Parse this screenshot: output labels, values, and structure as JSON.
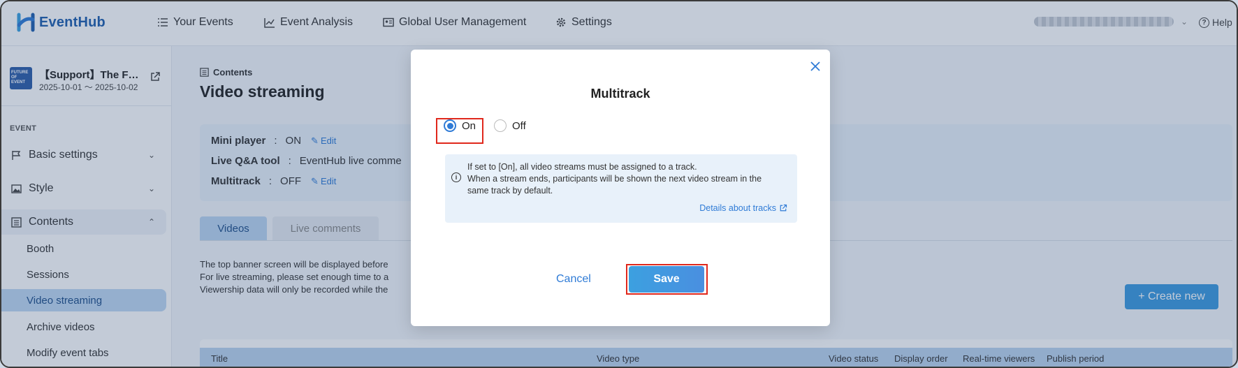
{
  "app": {
    "name": "EventHub"
  },
  "topnav": {
    "items": [
      {
        "label": "Your Events",
        "icon": "list-icon"
      },
      {
        "label": "Event Analysis",
        "icon": "chart-icon"
      },
      {
        "label": "Global User Management",
        "icon": "id-card-icon"
      },
      {
        "label": "Settings",
        "icon": "gear-icon"
      }
    ],
    "help_label": "Help"
  },
  "sidebar": {
    "event_title": "【Support】The F…",
    "event_dates": "2025-10-01 ～ 2025-10-02",
    "thumb_text": "FUTURE OF EVENT",
    "section_label": "EVENT",
    "items": [
      {
        "label": "Basic settings",
        "icon": "flag-icon"
      },
      {
        "label": "Style",
        "icon": "image-icon"
      },
      {
        "label": "Contents",
        "icon": "list-icon"
      }
    ],
    "subitems": [
      "Booth",
      "Sessions",
      "Video streaming",
      "Archive videos",
      "Modify event tabs"
    ]
  },
  "main": {
    "breadcrumb": "Contents",
    "title": "Video streaming",
    "settings": [
      {
        "label": "Mini player",
        "value": "ON",
        "edit": "Edit"
      },
      {
        "label": "Live Q&A tool",
        "value": "EventHub live comme",
        "edit": ""
      },
      {
        "label": "Multitrack",
        "value": "OFF",
        "edit": "Edit"
      }
    ],
    "tabs": [
      "Videos",
      "Live comments"
    ],
    "description": [
      "The top banner screen will be displayed before",
      "For live streaming, please set enough time to a",
      "Viewership data will only be recorded while the"
    ],
    "create_label": "+ Create new",
    "table_headers": [
      "Title",
      "Video type",
      "Video status",
      "Display order",
      "Real-time viewers",
      "Publish period"
    ]
  },
  "modal": {
    "title": "Multitrack",
    "options": [
      {
        "label": "On",
        "checked": true
      },
      {
        "label": "Off",
        "checked": false
      }
    ],
    "info_lines": [
      "If set to [On], all video streams must be assigned to a track.",
      "When a stream ends, participants will be shown the next video stream in the",
      "same track by default."
    ],
    "info_link": "Details about tracks",
    "cancel_label": "Cancel",
    "save_label": "Save"
  },
  "colors": {
    "accent": "#2f7bd6",
    "highlight": "#e0281c",
    "brand": "#1f5fae"
  }
}
